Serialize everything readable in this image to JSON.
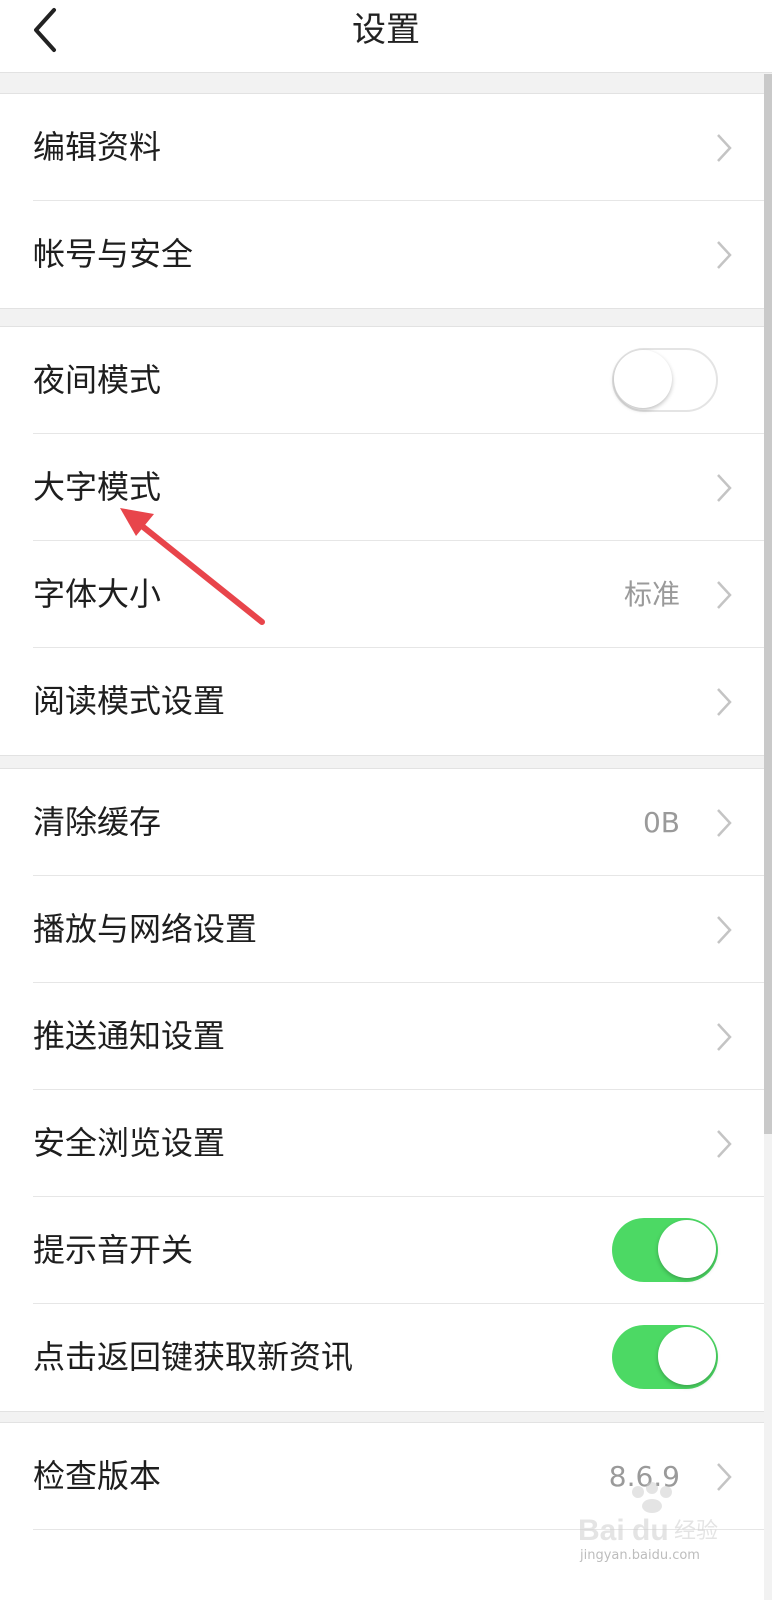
{
  "header": {
    "title": "设置"
  },
  "groups": [
    {
      "items": [
        {
          "label": "编辑资料"
        },
        {
          "label": "帐号与安全"
        }
      ]
    },
    {
      "items": [
        {
          "label": "夜间模式",
          "toggle": false
        },
        {
          "label": "大字模式"
        },
        {
          "label": "字体大小",
          "value": "标准"
        },
        {
          "label": "阅读模式设置"
        }
      ]
    },
    {
      "items": [
        {
          "label": "清除缓存",
          "value": "0B"
        },
        {
          "label": "播放与网络设置"
        },
        {
          "label": "推送通知设置"
        },
        {
          "label": "安全浏览设置"
        },
        {
          "label": "提示音开关",
          "toggle": true
        },
        {
          "label": "点击返回键获取新资讯",
          "toggle": true
        }
      ]
    },
    {
      "items": [
        {
          "label": "检查版本",
          "value": "8.6.9"
        }
      ]
    }
  ],
  "colors": {
    "toggle_on": "#4cd964",
    "annotation_arrow": "#e8454b",
    "background": "#f2f2f2"
  },
  "watermark": {
    "sub": "jingyan.baidu.com"
  }
}
